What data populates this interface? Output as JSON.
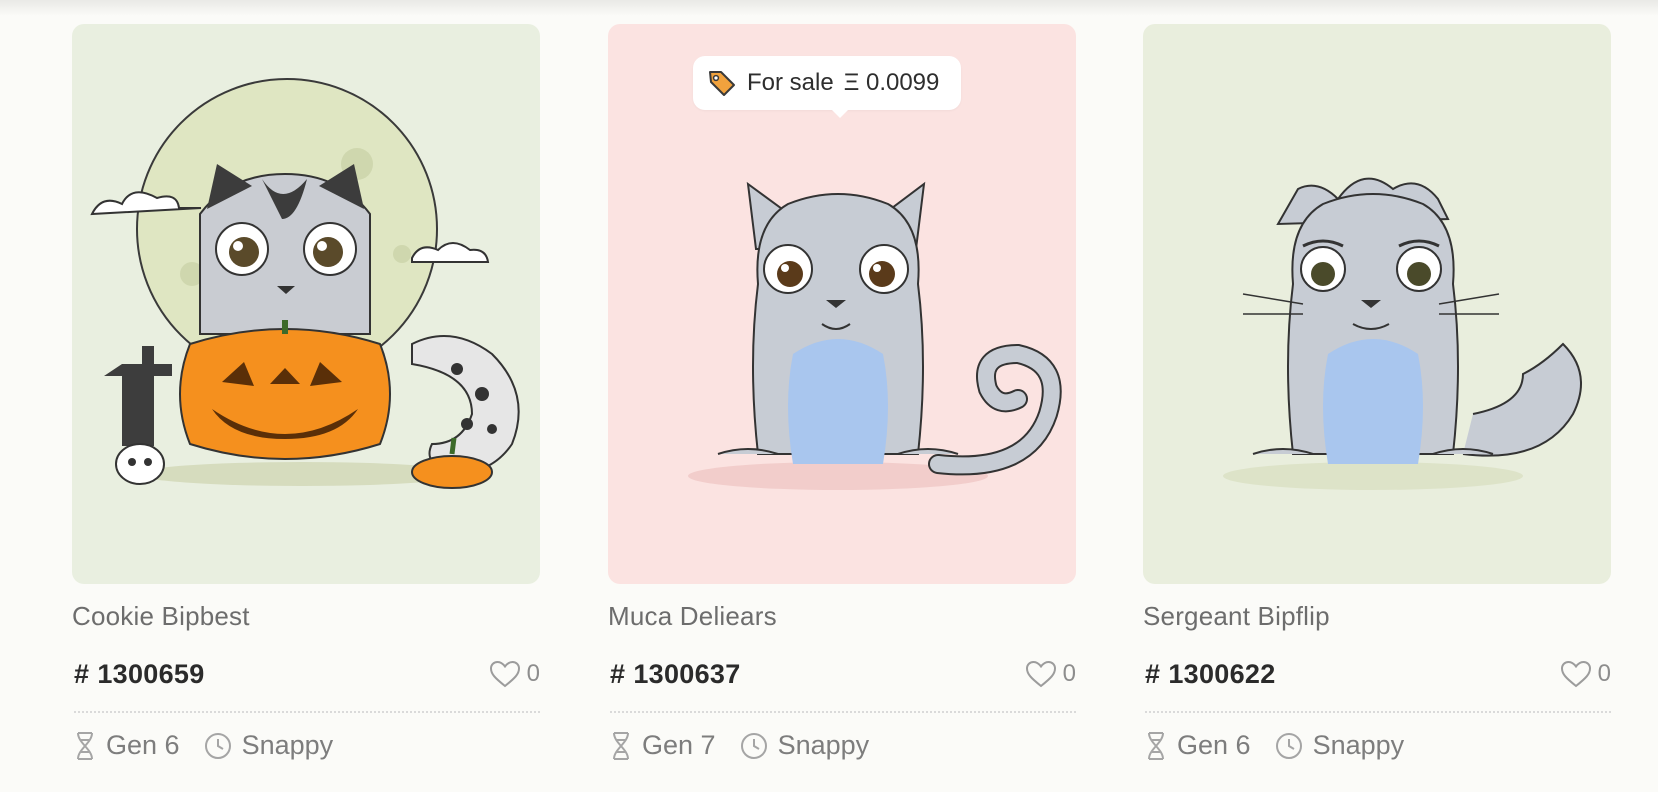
{
  "kitties": [
    {
      "name": "Cookie Bipbest",
      "id": "1300659",
      "likes": "0",
      "generation": "Gen 6",
      "cooldown": "Snappy",
      "background_color": "#e9efe0",
      "sale": null
    },
    {
      "name": "Muca Deliears",
      "id": "1300637",
      "likes": "0",
      "generation": "Gen 7",
      "cooldown": "Snappy",
      "background_color": "#fbe3e1",
      "sale": {
        "label": "For sale",
        "price": "Ξ 0.0099"
      }
    },
    {
      "name": "Sergeant Bipflip",
      "id": "1300622",
      "likes": "0",
      "generation": "Gen 6",
      "cooldown": "Snappy",
      "background_color": "#e9eedd",
      "sale": null
    }
  ],
  "symbols": {
    "hash": "#"
  },
  "icons": {
    "sale": "price-tag-icon",
    "likes": "heart-outline-icon",
    "generation": "dna-helix-icon",
    "cooldown": "clock-icon"
  },
  "colors": {
    "tag_orange": "#f1a23d",
    "kitty_gray": "#c7ccd4",
    "kitty_belly": "#a9c6ee",
    "pumpkin": "#f5901e"
  }
}
